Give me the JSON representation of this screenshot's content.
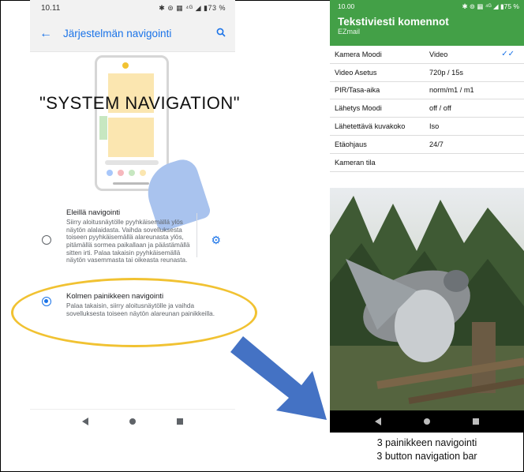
{
  "left_phone": {
    "status": {
      "time": "10.11",
      "right_icons": "✱ ⊚ ▦ ⁴ᴳ ◢ ▮73 %"
    },
    "appbar": {
      "title": "Järjestelmän navigointi"
    },
    "overlay_label": "\"SYSTEM NAVIGATION\"",
    "options": [
      {
        "title": "Eleillä navigointi",
        "description": "Siirry aloitusnäytölle pyyhkäisemällä ylös näytön alalaidasta. Vaihda sovelluksesta toiseen pyyhkäisemällä alareunasta ylös, pitämällä sormea paikallaan ja päästämällä sitten irti. Palaa takaisin pyyhkäisemällä näytön vasemmasta tai oikeasta reunasta.",
        "selected": false
      },
      {
        "title": "Kolmen painikkeen navigointi",
        "description": "Palaa takaisin, siirry aloitusnäytölle ja vaihda sovelluksesta toiseen näytön alareunan painikkeilla.",
        "selected": true
      }
    ]
  },
  "right_phone": {
    "status": {
      "time": "10.00",
      "right_icons": "✱ ⊚ ▦ ⁴ᴳ ◢ ▮75 %"
    },
    "appbar": {
      "title": "Tekstiviesti komennot",
      "subtitle": "EZmail"
    },
    "rows": [
      {
        "key": "Kamera Moodi",
        "value": "Video",
        "checked": true
      },
      {
        "key": "Video Asetus",
        "value": "720p / 15s"
      },
      {
        "key": "PIR/Tasa-aika",
        "value": "norm/m1 / m1"
      },
      {
        "key": "Lähetys Moodi",
        "value": "off / off"
      },
      {
        "key": "Lähetettävä kuvakoko",
        "value": "Iso"
      },
      {
        "key": "Etäohjaus",
        "value": "24/7"
      },
      {
        "key": "Kameran tila",
        "value": ""
      }
    ]
  },
  "caption": {
    "line1": "3 painikkeen navigointi",
    "line2": "3 button navigation bar"
  },
  "colors": {
    "accent_blue": "#1a73e8",
    "green_header": "#43a047",
    "highlight_ellipse": "#f1c232",
    "arrow_blue": "#4472c4"
  }
}
